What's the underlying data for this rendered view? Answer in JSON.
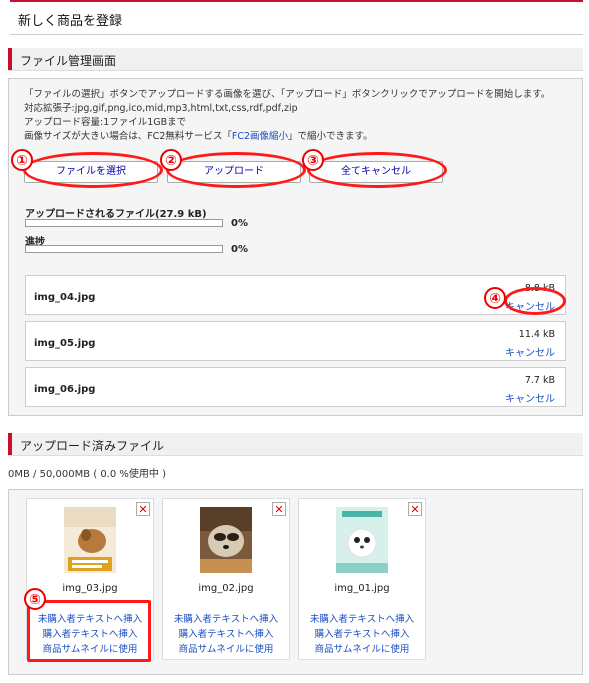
{
  "page_title": "新しく商品を登録",
  "file_manager": {
    "heading": "ファイル管理画面",
    "desc_line1": "「ファイルの選択」ボタンでアップロードする画像を選び、「アップロード」ボタンクリックでアップロードを開始します。",
    "desc_line2": "対応拡張子:jpg,gif,png,ico,mid,mp3,html,txt,css,rdf,pdf,zip",
    "desc_line3": "アップロード容量:1ファイル1GBまで",
    "desc_line4_pre": "画像サイズが大きい場合は、FC2無料サービス「",
    "desc_line4_link": "FC2画像縮小",
    "desc_line4_post": "」で縮小できます。",
    "buttons": {
      "select": "ファイルを選択",
      "upload": "アップロード",
      "cancel_all": "全てキャンセル"
    },
    "upload_progress_label": "アップロードされるファイル(27.9 kB)",
    "upload_progress_value": "0%",
    "upload_progress_fraction": 0,
    "progress_label": "進捗",
    "progress_value": "0%",
    "progress_fraction": 0,
    "queue": [
      {
        "name": "img_04.jpg",
        "size": "8.8 kB",
        "cancel": "キャンセル"
      },
      {
        "name": "img_05.jpg",
        "size": "11.4 kB",
        "cancel": "キャンセル"
      },
      {
        "name": "img_06.jpg",
        "size": "7.7 kB",
        "cancel": "キャンセル"
      }
    ]
  },
  "uploaded": {
    "heading": "アップロード済みファイル",
    "usage": "0MB / 50,000MB ( 0.0 %使用中 )",
    "delete_symbol": "✕",
    "files": [
      {
        "name": "img_03.jpg",
        "action1": "未購入者テキストへ挿入",
        "action2": "購入者テキストへ挿入",
        "action3": "商品サムネイルに使用"
      },
      {
        "name": "img_02.jpg",
        "action1": "未購入者テキストへ挿入",
        "action2": "購入者テキストへ挿入",
        "action3": "商品サムネイルに使用"
      },
      {
        "name": "img_01.jpg",
        "action1": "未購入者テキストへ挿入",
        "action2": "購入者テキストへ挿入",
        "action3": "商品サムネイルに使用"
      }
    ]
  },
  "annotations": [
    "①",
    "②",
    "③",
    "④",
    "⑤"
  ],
  "colors": {
    "accent": "#c8102e",
    "annotation": "#ff1a1a",
    "link": "#1a4fbf"
  }
}
